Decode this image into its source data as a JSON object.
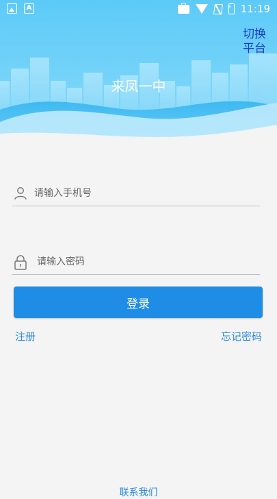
{
  "status_bar": {
    "time": "11:19",
    "left_icons": [
      "image-icon",
      "a-icon"
    ],
    "right_icons": [
      "briefcase-icon",
      "wifi-icon",
      "no-signal-icon",
      "battery-charging-icon"
    ]
  },
  "header": {
    "title": "来凤一中",
    "switch_platform": "切换\n平台"
  },
  "form": {
    "phone_placeholder": "请输入手机号",
    "password_placeholder": "请输入密码",
    "login_label": "登录",
    "register_label": "注册",
    "forgot_label": "忘记密码"
  },
  "footer": {
    "contact_label": "联系我们"
  },
  "colors": {
    "primary": "#1f8ce6",
    "sky_top": "#5cc8f6",
    "link": "#2a8be0",
    "switch_text": "#1a3cc7"
  }
}
